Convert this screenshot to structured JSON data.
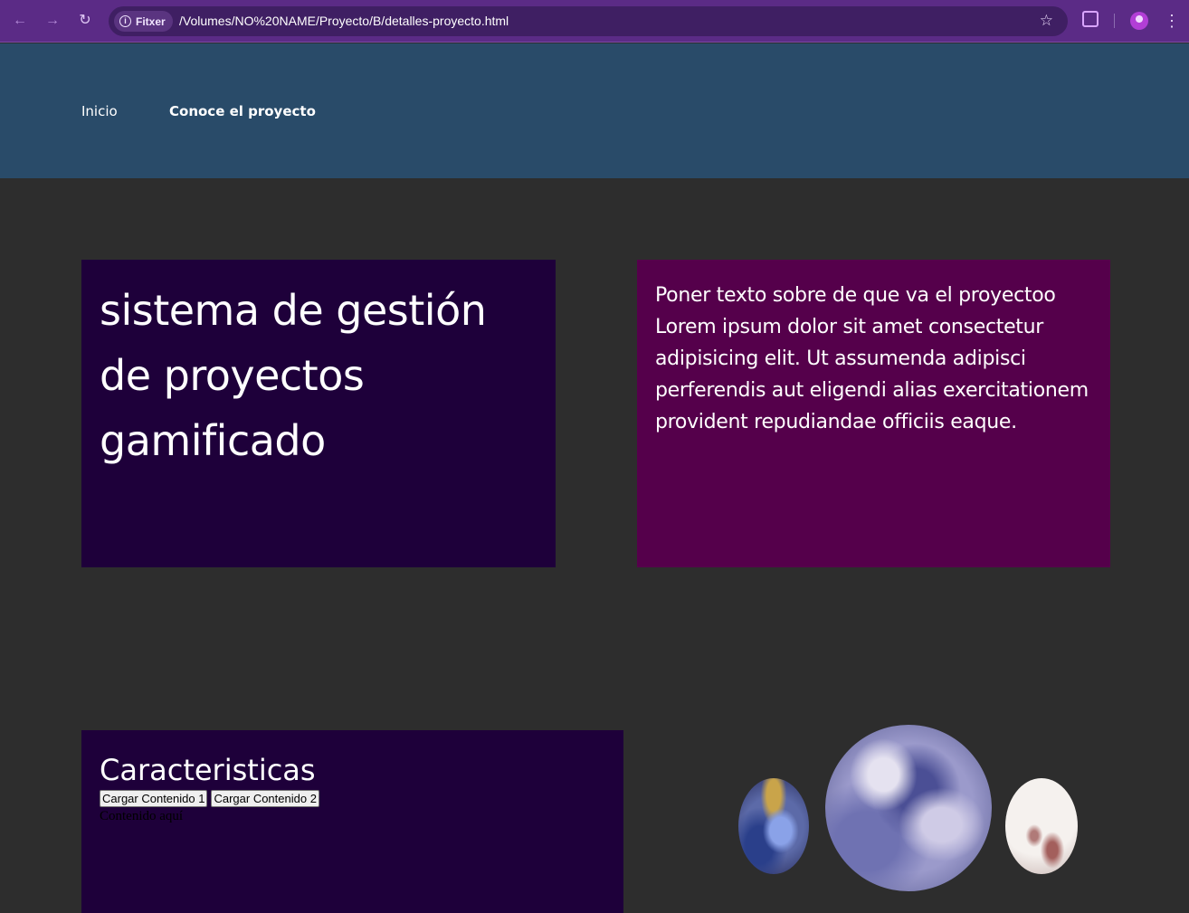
{
  "browser": {
    "site_chip_label": "Fitxer",
    "url": "/Volumes/NO%20NAME/Proyecto/B/detalles-proyecto.html",
    "colors": {
      "toolbar": "#5b2b86",
      "omnibox": "#3f1f63"
    }
  },
  "header": {
    "nav": [
      {
        "label": "Inicio"
      },
      {
        "label": "Conoce el proyecto"
      }
    ],
    "color": "#294b69"
  },
  "hero": {
    "title": "sistema de gestión de proyectos gamificado",
    "description": "Poner texto sobre de que va el proyectoo Lorem ipsum dolor sit amet consectetur adipisicing elit. Ut assumenda adipisci perferendis aut eligendi alias exercitationem provident repudiandae officiis eaque.",
    "title_bg": "#1e003a",
    "description_bg": "#55004b"
  },
  "features": {
    "heading": "Caracteristicas",
    "buttons": [
      {
        "label": "Cargar Contenido 1"
      },
      {
        "label": "Cargar Contenido 2"
      }
    ],
    "content_text": "Contenido aquí"
  },
  "planets": [
    "small-blue-planet",
    "large-marbled-planet",
    "white-speckled-planet"
  ]
}
